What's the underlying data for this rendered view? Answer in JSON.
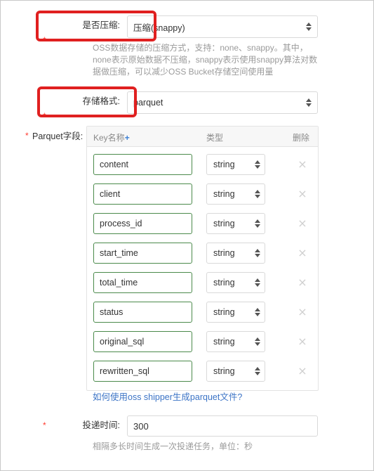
{
  "form": {
    "compression": {
      "label": "是否压缩:",
      "value": "压缩(snappy)",
      "required_marker": "*",
      "help": "OSS数据存储的压缩方式，支持：none、snappy。其中，none表示原始数据不压缩，snappy表示使用snappy算法对数据做压缩，可以减少OSS Bucket存储空间使用量"
    },
    "storage_format": {
      "label": "存储格式:",
      "value": "parquet",
      "required_marker": "*"
    },
    "parquet_fields": {
      "label": "Parquet字段:",
      "required_marker": "*",
      "columns": {
        "key": "Key名称",
        "key_add": "+",
        "type": "类型",
        "delete": "删除"
      },
      "rows": [
        {
          "key": "content",
          "type": "string",
          "delete_icon": "×"
        },
        {
          "key": "client",
          "type": "string",
          "delete_icon": "×"
        },
        {
          "key": "process_id",
          "type": "string",
          "delete_icon": "×"
        },
        {
          "key": "start_time",
          "type": "string",
          "delete_icon": "×"
        },
        {
          "key": "total_time",
          "type": "string",
          "delete_icon": "×"
        },
        {
          "key": "status",
          "type": "string",
          "delete_icon": "×"
        },
        {
          "key": "original_sql",
          "type": "string",
          "delete_icon": "×"
        },
        {
          "key": "rewritten_sql",
          "type": "string",
          "delete_icon": "×"
        }
      ],
      "doc_link": "如何使用oss shipper生成parquet文件?"
    },
    "delivery_time": {
      "label": "投递时间:",
      "value": "300",
      "required_marker": "*",
      "help": "相隔多长时间生成一次投递任务，单位：秒"
    }
  },
  "annotations": [
    {
      "name": "compression-highlight"
    },
    {
      "name": "storage-format-highlight"
    }
  ],
  "colors": {
    "annotation_red": "#e02020",
    "link_blue": "#3c74c6",
    "valid_green": "#4b8a4b",
    "required_red": "#ff3b30"
  }
}
